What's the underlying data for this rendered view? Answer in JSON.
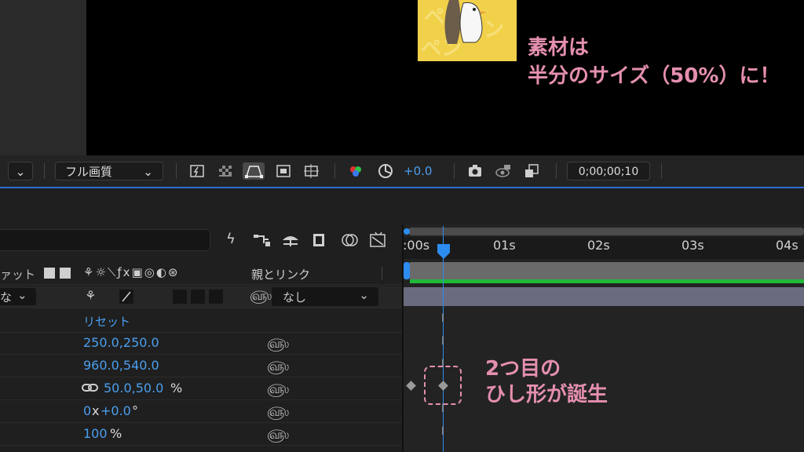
{
  "viewer": {
    "annotation_line1": "素材は",
    "annotation_line2": "半分のサイズ（50%）に！"
  },
  "viewer_toolbar": {
    "resolution": "フル画質",
    "exposure": "+0.0",
    "timecode": "0;00;00;10"
  },
  "layer_header": {
    "label_partial": "ァット",
    "parent_link": "親とリンク",
    "mode_partial": "な",
    "parent_value": "なし"
  },
  "properties": [
    {
      "value": "リセット",
      "has_spiral": false
    },
    {
      "value": "250.0,250.0",
      "has_spiral": true
    },
    {
      "value": "960.0,540.0",
      "has_spiral": true
    },
    {
      "value": "50.0,50.0",
      "suffix": "%",
      "has_link": true,
      "has_spiral": true
    },
    {
      "value_a": "0",
      "x": "x",
      "value_b": "+0.0",
      "suffix": "°",
      "has_spiral": true
    },
    {
      "value": "100",
      "suffix": "%",
      "has_spiral": true
    }
  ],
  "timeline": {
    "ticks": [
      ":00s",
      "01s",
      "02s",
      "03s",
      "04s"
    ],
    "annotation_line1": "2つ目の",
    "annotation_line2": "ひし形が誕生"
  },
  "colors": {
    "accent_blue": "#2d8cf0",
    "annotation_pink": "#e58fb0",
    "track_green": "#22b83a",
    "value_blue": "#4a9ff0"
  }
}
